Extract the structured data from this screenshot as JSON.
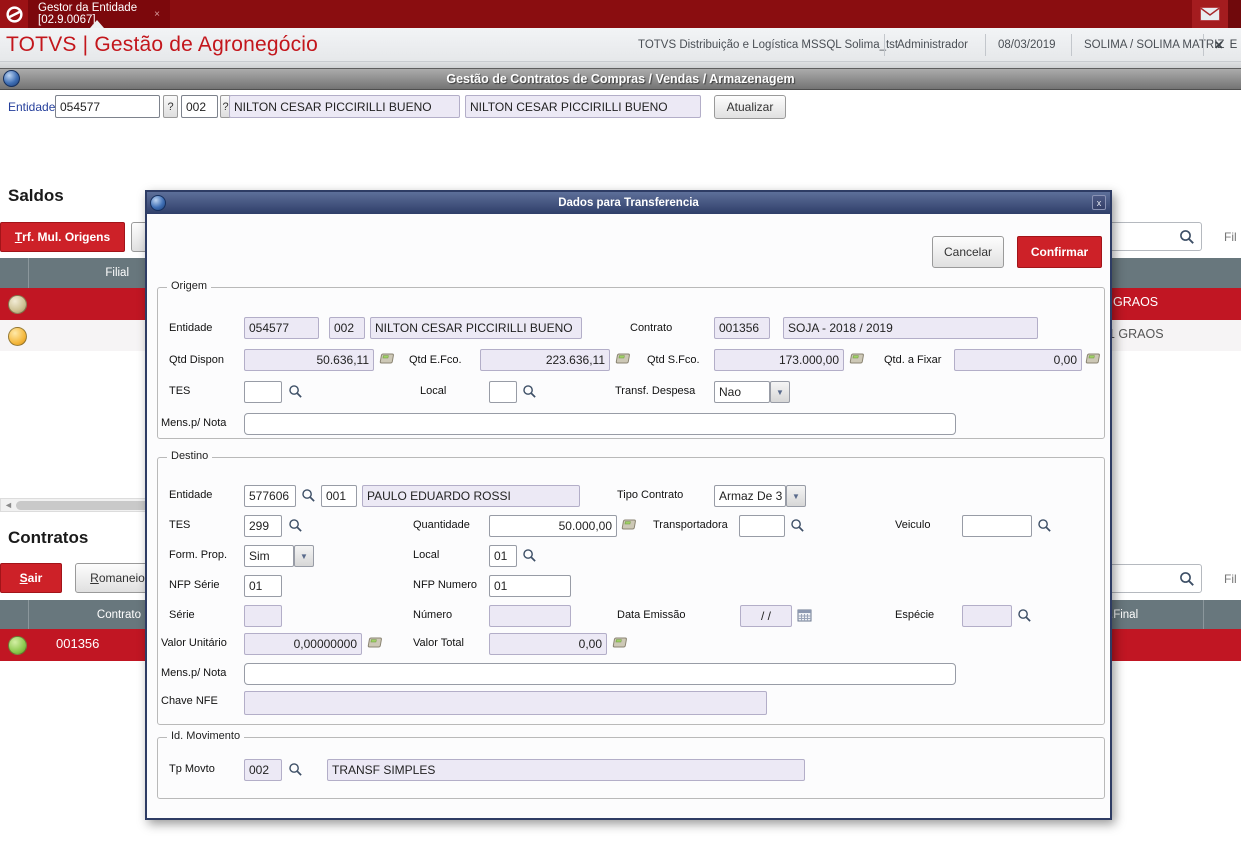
{
  "colors": {
    "accent_red": "#cd2128",
    "row_red": "#c11623",
    "header_slate": "#68777d",
    "brand_red": "#c3161c",
    "lavender": "#ece9f5",
    "modal_blue": "#2f3e69",
    "topbar_red": "#8a0d10"
  },
  "glyphs": {
    "dropdown": "▼",
    "scroll_left": "◄",
    "help": "?",
    "tab_close": "×",
    "modal_close": "x",
    "exit_x": "✕"
  },
  "window": {
    "tab_title": "Gestor da Entidade [02.9.0067]"
  },
  "header": {
    "brand": "TOTVS | Gestão de Agronegócio",
    "environment": "TOTVS Distribuição e Logística MSSQL Solima_tst",
    "user": "Administrador",
    "date": "08/03/2019",
    "company": "SOLIMA / SOLIMA MATRIZ",
    "exit_label": "E"
  },
  "toolbar": {
    "title": "Gestão de Contratos de Compras / Vendas / Armazenagem"
  },
  "entity_bar": {
    "label": "Entidade",
    "code": "054577",
    "store": "002",
    "name": "NILTON CESAR PICCIRILLI BUENO",
    "name2": "NILTON CESAR PICCIRILLI BUENO",
    "refresh": "Atualizar"
  },
  "saldos": {
    "title": "Saldos",
    "trf_button": {
      "prefix": "T",
      "rest": "rf. Mul. Origens"
    },
    "filter_label": "Fil",
    "table": {
      "col_filial": "Filial",
      "row1_product": "GRAOS",
      "row2_product": "1 GRAOS"
    }
  },
  "contratos": {
    "title": "Contratos",
    "sair": {
      "prefix": "S",
      "rest": "air"
    },
    "romaneio": {
      "prefix": "R",
      "rest": "omaneio"
    },
    "filter_label": "Fil",
    "table": {
      "col_contrato": "Contrato",
      "col_final": ".Final",
      "row1_contrato": "001356"
    }
  },
  "modal": {
    "title": "Dados para Transferencia",
    "cancel": "Cancelar",
    "confirm": "Confirmar",
    "origem": {
      "legend": "Origem",
      "lbl_entidade": "Entidade",
      "entidade_cod": "054577",
      "loja": "002",
      "entidade_nome": "NILTON CESAR PICCIRILLI BUENO",
      "lbl_contrato": "Contrato",
      "contrato_cod": "001356",
      "contrato_desc": "SOJA  - 2018 / 2019",
      "lbl_qtd_dispon": "Qtd Dispon",
      "qtd_dispon": "50.636,11",
      "lbl_qtd_efco": "Qtd E.Fco.",
      "qtd_efco": "223.636,11",
      "lbl_qtd_sfco": "Qtd S.Fco.",
      "qtd_sfco": "173.000,00",
      "lbl_qtd_fixar": "Qtd. a Fixar",
      "qtd_fixar": "0,00",
      "lbl_tes": "TES",
      "tes": "",
      "lbl_local": "Local",
      "local": "",
      "lbl_transf_despesa": "Transf. Despesa",
      "transf_despesa": "Nao",
      "lbl_mens": "Mens.p/ Nota",
      "mens": ""
    },
    "destino": {
      "legend": "Destino",
      "lbl_entidade": "Entidade",
      "entidade_cod": "577606",
      "loja": "001",
      "entidade_nome": "PAULO EDUARDO ROSSI",
      "lbl_tipo_contrato": "Tipo Contrato",
      "tipo_contrato": "Armaz De 3",
      "lbl_tes": "TES",
      "tes": "299",
      "lbl_quantidade": "Quantidade",
      "quantidade": "50.000,00",
      "lbl_transportadora": "Transportadora",
      "transportadora": "",
      "lbl_veiculo": "Veiculo",
      "veiculo": "",
      "lbl_form_prop": "Form. Prop.",
      "form_prop": "Sim",
      "lbl_local": "Local",
      "local": "01",
      "lbl_nfp_serie": "NFP Série",
      "nfp_serie": "01",
      "lbl_nfp_numero": "NFP Numero",
      "nfp_numero": "01",
      "lbl_serie": "Série",
      "serie": "",
      "lbl_numero": "Número",
      "numero": "",
      "lbl_data_emissao": "Data Emissão",
      "data_emissao": "/ /",
      "lbl_especie": "Espécie",
      "especie": "",
      "lbl_valor_unitario": "Valor Unitário",
      "valor_unitario": "0,00000000",
      "lbl_valor_total": "Valor Total",
      "valor_total": "0,00",
      "lbl_mens": "Mens.p/ Nota",
      "mens": "",
      "lbl_chave": "Chave NFE",
      "chave": ""
    },
    "movimento": {
      "legend": "Id. Movimento",
      "lbl_tp_movto": "Tp Movto",
      "tp_movto_cod": "002",
      "tp_movto_desc": "TRANSF SIMPLES"
    }
  }
}
